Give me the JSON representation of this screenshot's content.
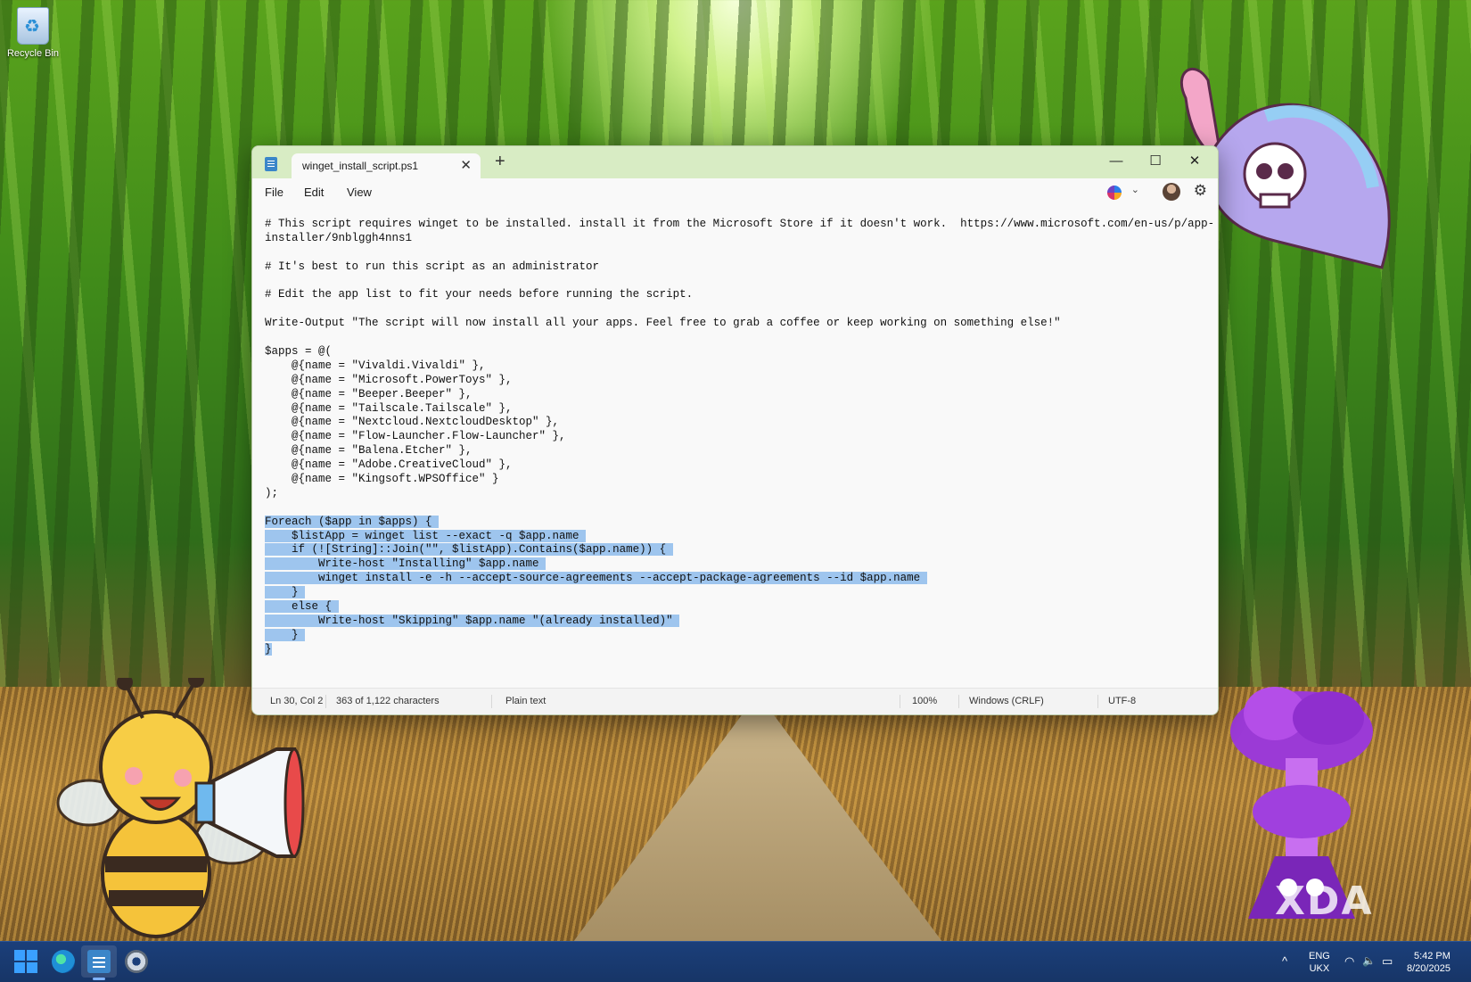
{
  "desktop": {
    "recycle_bin_label": "Recycle Bin",
    "watermark": "XDA"
  },
  "window": {
    "tab_title": "winget_install_script.ps1",
    "close_tab_glyph": "✕",
    "new_tab_glyph": "+",
    "minimize_glyph": "—",
    "maximize_glyph": "☐",
    "close_glyph": "✕",
    "menu": [
      "File",
      "Edit",
      "View"
    ],
    "chevron_glyph": "⌄",
    "settings_glyph": "⚙"
  },
  "editor": {
    "lines": [
      "# This script requires winget to be installed. install it from the Microsoft Store if it doesn't work.  https://www.microsoft.com/en-us/p/app-",
      "installer/9nblggh4nns1",
      "",
      "# It's best to run this script as an administrator",
      "",
      "# Edit the app list to fit your needs before running the script.",
      "",
      "Write-Output \"The script will now install all your apps. Feel free to grab a coffee or keep working on something else!\"",
      "",
      "$apps = @(",
      "    @{name = \"Vivaldi.Vivaldi\" },",
      "    @{name = \"Microsoft.PowerToys\" },",
      "    @{name = \"Beeper.Beeper\" },",
      "    @{name = \"Tailscale.Tailscale\" },",
      "    @{name = \"Nextcloud.NextcloudDesktop\" },",
      "    @{name = \"Flow-Launcher.Flow-Launcher\" },",
      "    @{name = \"Balena.Etcher\" },",
      "    @{name = \"Adobe.CreativeCloud\" },",
      "    @{name = \"Kingsoft.WPSOffice\" }",
      ");",
      "",
      "Foreach ($app in $apps) { ",
      "    $listApp = winget list --exact -q $app.name ",
      "    if (![String]::Join(\"\", $listApp).Contains($app.name)) { ",
      "        Write-host \"Installing\" $app.name ",
      "        winget install -e -h --accept-source-agreements --accept-package-agreements --id $app.name ",
      "    } ",
      "    else { ",
      "        Write-host \"Skipping\" $app.name \"(already installed)\" ",
      "    } ",
      "}"
    ],
    "selected_from_line": 21
  },
  "status": {
    "position": "Ln 30, Col 2",
    "selection": "363 of 1,122 characters",
    "format": "Plain text",
    "zoom": "100%",
    "line_ending": "Windows (CRLF)",
    "encoding": "UTF-8"
  },
  "taskbar": {
    "chevron_glyph": "^",
    "lang_top": "ENG",
    "lang_bottom": "UKX",
    "time": "5:42 PM",
    "date": "8/20/2025",
    "wifi_glyph": "◠",
    "volume_glyph": "🔈",
    "battery_glyph": "▭"
  }
}
